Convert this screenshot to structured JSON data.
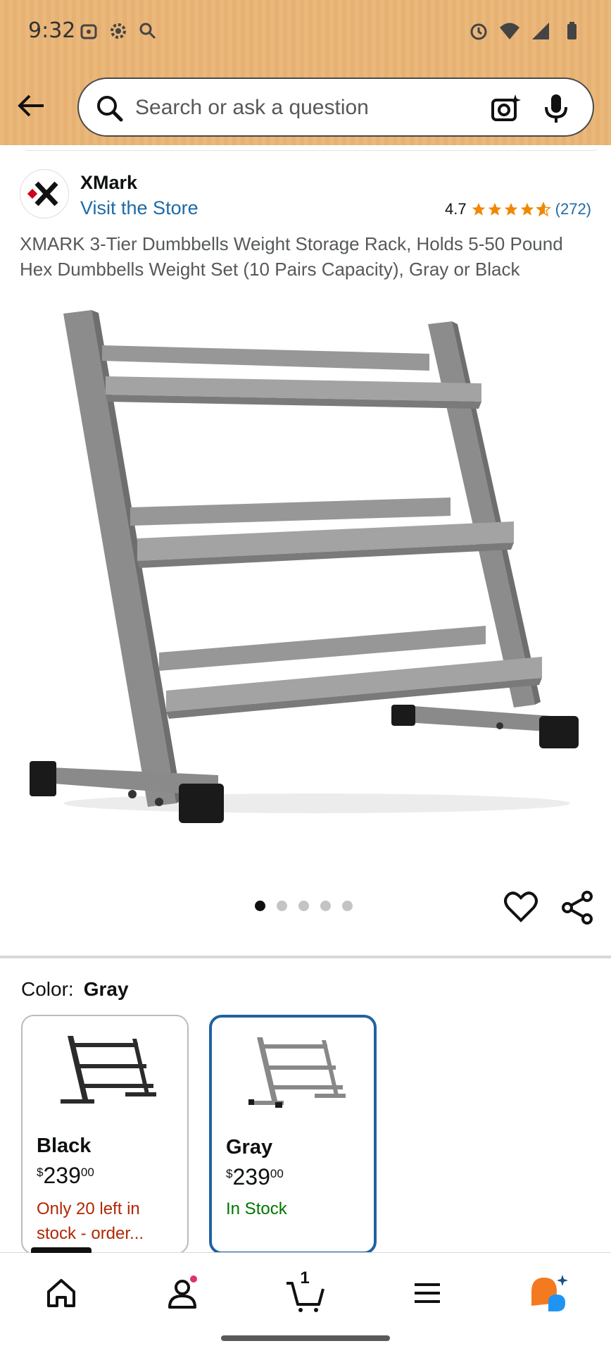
{
  "status_bar": {
    "time": "9:32"
  },
  "search": {
    "placeholder": "Search or ask a question"
  },
  "store": {
    "brand": "XMark",
    "visit_label": "Visit the Store",
    "rating": "4.7",
    "rating_count": "(272)",
    "stars_value": 4.7
  },
  "product": {
    "title": "XMARK 3-Tier Dumbbells Weight Storage Rack, Holds 5-50 Pound Hex Dumbbells Weight Set (10 Pairs Capacity), Gray or Black",
    "image_count": 5,
    "active_image": 1
  },
  "color": {
    "label": "Color:",
    "selected": "Gray",
    "options": [
      {
        "name": "Black",
        "currency": "$",
        "dollars": "239",
        "cents": "00",
        "stock": "Only 20 left in stock - order...",
        "frame_color": "#2b2b2b"
      },
      {
        "name": "Gray",
        "currency": "$",
        "dollars": "239",
        "cents": "00",
        "stock": "In Stock",
        "frame_color": "#888888"
      }
    ]
  },
  "nav": {
    "cart_count": "1",
    "items": [
      "home-icon",
      "account-icon",
      "cart-icon",
      "menu-icon",
      "rufus-icon"
    ]
  },
  "colors": {
    "header_bg": "#e8b678",
    "link": "#1f6aa5",
    "star": "#f08804",
    "selected_border": "#2162a1",
    "in_stock": "#007600",
    "low_stock": "#b12704"
  }
}
